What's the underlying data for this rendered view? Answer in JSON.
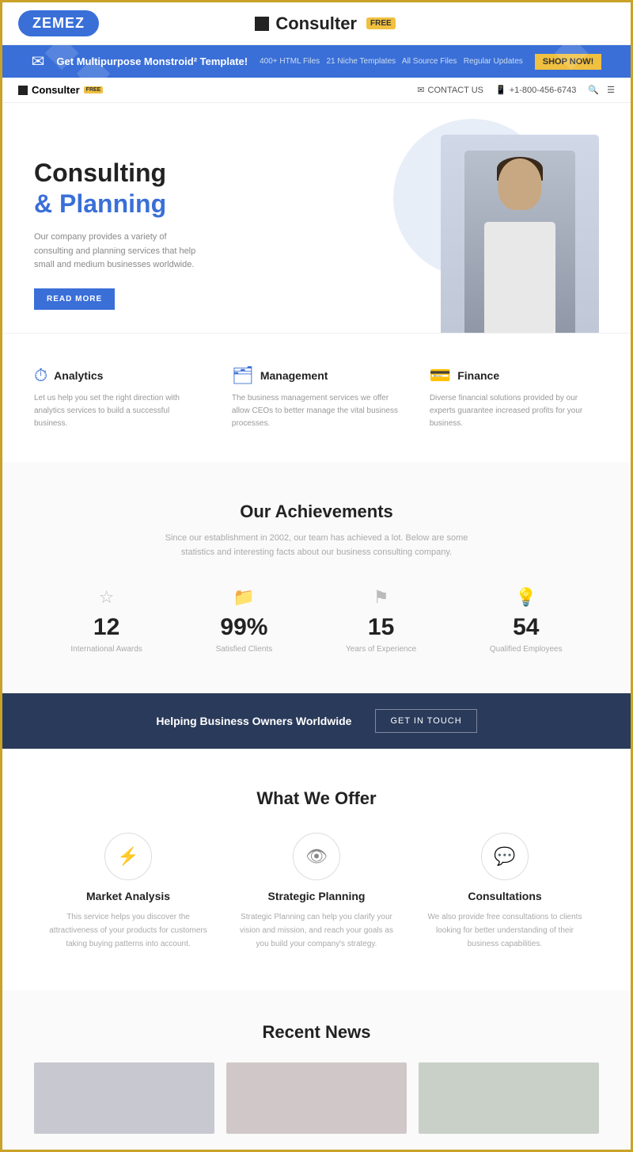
{
  "frame": {
    "outer_border_color": "#c9a227"
  },
  "top_bar": {
    "zemez_label": "ZEMEZ",
    "consulter_label": "Consulter",
    "free_badge": "FREE"
  },
  "promo_banner": {
    "text": "Get Multipurpose Monstroid² Template!",
    "sub_items": [
      "400+ HTML Files",
      "21 Niche Templates",
      "All Source Files",
      "Regular Updates"
    ],
    "button_label": "SHOP NOW!"
  },
  "nav": {
    "logo_label": "Consulter",
    "free_badge": "FREE",
    "contact_label": "CONTACT US",
    "phone_label": "+1-800-456-6743"
  },
  "hero": {
    "title_line1": "Consulting",
    "title_line2": "& Planning",
    "description": "Our company provides a variety of consulting and planning services that help small and medium businesses worldwide.",
    "button_label": "READ MORE"
  },
  "features": [
    {
      "icon": "⏱",
      "name": "Analytics",
      "desc": "Let us help you set the right direction with analytics services to build a successful business."
    },
    {
      "icon": "🗂",
      "name": "Management",
      "desc": "The business management services we offer allow CEOs to better manage the vital business processes."
    },
    {
      "icon": "💳",
      "name": "Finance",
      "desc": "Diverse financial solutions provided by our experts guarantee increased profits for your business."
    }
  ],
  "achievements": {
    "section_title": "Our Achievements",
    "section_subtitle": "Since our establishment in 2002, our team has achieved a lot. Below are some statistics and interesting facts about our business consulting company.",
    "stats": [
      {
        "icon": "☆",
        "number": "12",
        "label": "International Awards"
      },
      {
        "icon": "📁",
        "number": "99%",
        "label": "Satisfied Clients"
      },
      {
        "icon": "⚑",
        "number": "15",
        "label": "Years of Experience"
      },
      {
        "icon": "💡",
        "number": "54",
        "label": "Qualified Employees"
      }
    ]
  },
  "cta": {
    "text": "Helping Business Owners Worldwide",
    "button_label": "GET IN TOUCH"
  },
  "what_offer": {
    "section_title": "What We Offer",
    "items": [
      {
        "icon": "⚡",
        "name": "Market Analysis",
        "desc": "This service helps you discover the attractiveness of your products for customers taking buying patterns into account."
      },
      {
        "icon": "👁",
        "name": "Strategic Planning",
        "desc": "Strategic Planning can help you clarify your vision and mission, and reach your goals as you build your company's strategy."
      },
      {
        "icon": "💬",
        "name": "Consultations",
        "desc": "We also provide free consultations to clients looking for better understanding of their business capabilities."
      }
    ]
  },
  "recent_news": {
    "section_title": "Recent News"
  }
}
